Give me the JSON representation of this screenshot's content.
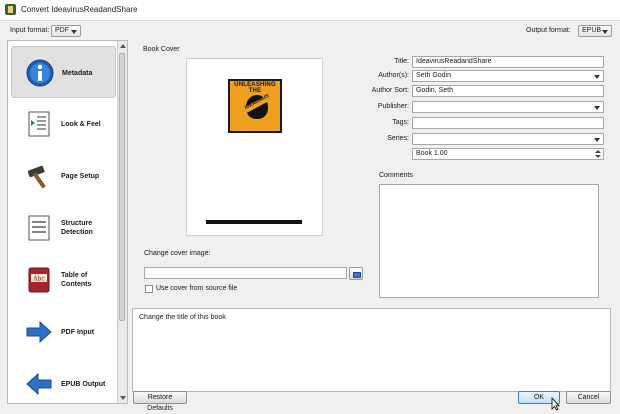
{
  "window": {
    "title": "Convert IdeavirusReadandShare"
  },
  "formats": {
    "input_label": "Input format:",
    "input_value": "PDF",
    "output_label": "Output format:",
    "output_value": "EPUB"
  },
  "sidebar": {
    "items": [
      {
        "label": "Metadata",
        "icon": "info-icon"
      },
      {
        "label": "Look & Feel",
        "icon": "look-and-feel-icon"
      },
      {
        "label": "Page Setup",
        "icon": "hammer-icon"
      },
      {
        "label": "Structure Detection",
        "icon": "structure-detection-icon"
      },
      {
        "label": "Table of Contents",
        "icon": "table-of-contents-icon"
      },
      {
        "label": "PDF Input",
        "icon": "arrow-right-icon"
      },
      {
        "label": "EPUB Output",
        "icon": "arrow-left-icon"
      }
    ]
  },
  "metadata": {
    "book_cover_label": "Book Cover",
    "cover_title_text": "UNLEASHING THE",
    "cover_subtitle_text": "IDEAVIRUS",
    "change_cover_label": "Change cover image:",
    "cover_path_value": "",
    "use_cover_label": "Use cover from source file",
    "title_label": "Title:",
    "title_value": "IdeavirusReadandShare",
    "authors_label": "Author(s):",
    "authors_value": "Seth Godin",
    "author_sort_label": "Author Sort:",
    "author_sort_value": "Godin, Seth",
    "publisher_label": "Publisher:",
    "publisher_value": "",
    "tags_label": "Tags:",
    "tags_value": "",
    "series_label": "Series:",
    "series_value": "",
    "series_index_value": "Book 1.00",
    "comments_label": "Comments"
  },
  "help_text": "Change the title of this book",
  "buttons": {
    "restore_defaults": "Restore Defaults",
    "ok": "OK",
    "cancel": "Cancel"
  }
}
